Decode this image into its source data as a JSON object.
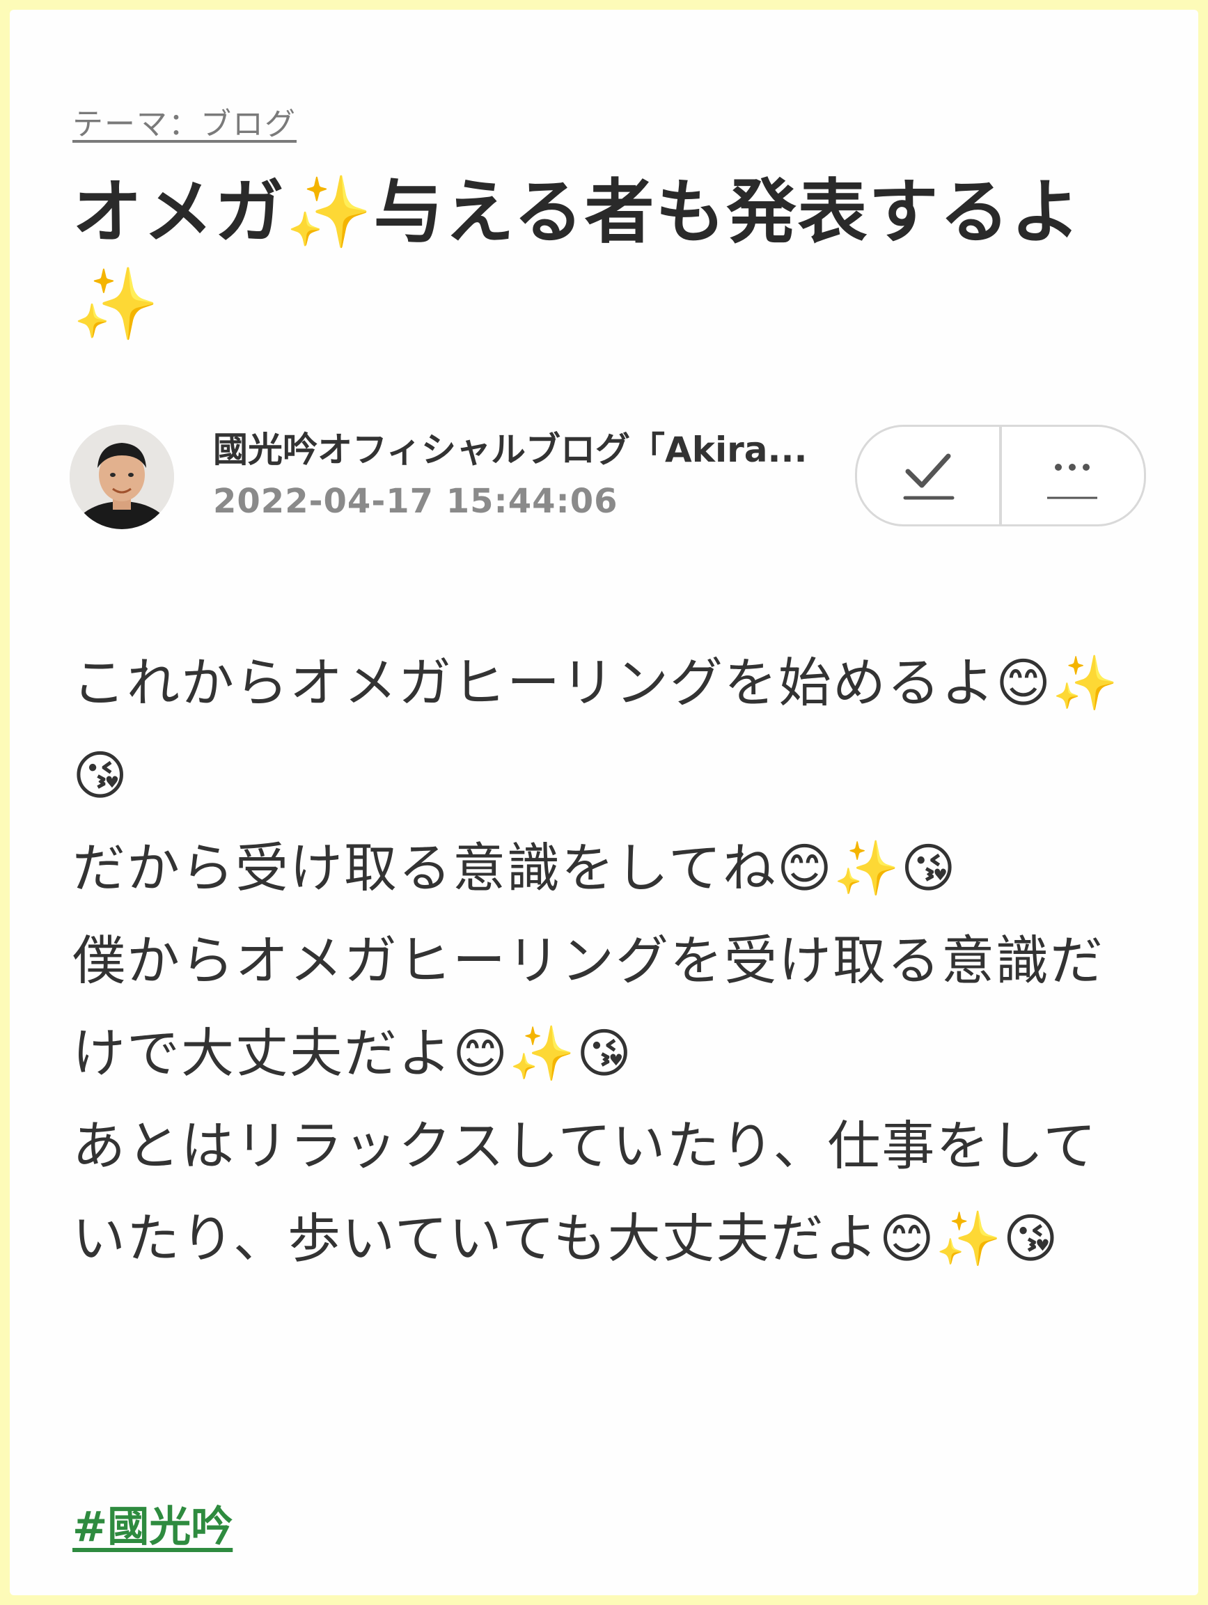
{
  "theme": {
    "label": "テーマ：ブログ"
  },
  "title": {
    "text": "オメガ",
    "sparkle": "✨",
    "text2": "与える者も発表するよ",
    "sparkle2": "✨"
  },
  "author": {
    "name": "國光吟オフィシャルブログ「Akira...",
    "date": "2022-04-17 15:44:06"
  },
  "actions": {
    "check_icon": "check-icon",
    "more_icon": "more-icon"
  },
  "body": {
    "line1": "これからオメガヒーリングを始めるよ",
    "line2": "だから受け取る意識をしてね",
    "line3": "僕からオメガヒーリングを受け取る意識だけで大丈夫だよ",
    "line4": "あとはリラックスしていたり、仕事をしていたり、歩いていても大丈夫だよ",
    "emoji_smile": "😊",
    "emoji_sparkles": "✨",
    "emoji_kiss": "😘"
  },
  "hashtag": {
    "label": "#國光吟"
  },
  "colors": {
    "frame": "#fdfbb8",
    "hashtag": "#2e8b3f",
    "muted": "#8a8a8a"
  }
}
